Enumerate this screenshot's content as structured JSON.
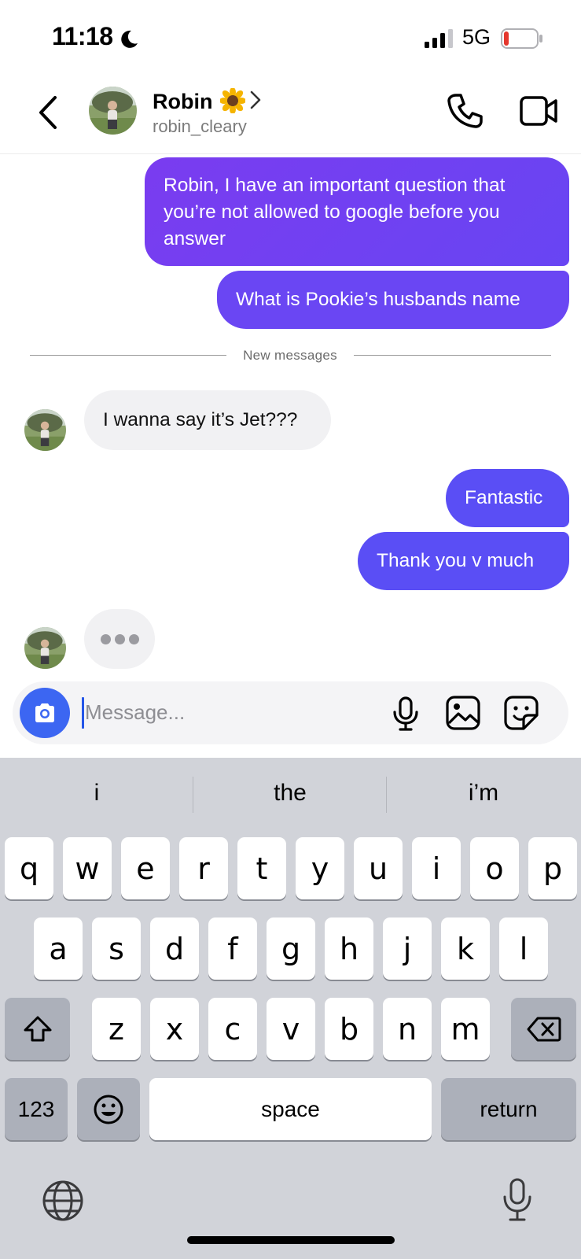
{
  "status_bar": {
    "time": "11:18",
    "network": "5G",
    "battery_color": "#e5372d"
  },
  "header": {
    "contact_name": "Robin",
    "contact_emoji": "sunflower",
    "contact_handle": "robin_cleary"
  },
  "messages": [
    {
      "direction": "outgoing",
      "text": "Robin, I have an important question that you’re not allowed to google before you answer"
    },
    {
      "direction": "outgoing",
      "text": "What is Pookie’s husbands name"
    },
    {
      "direction": "incoming",
      "text": "I wanna say it’s Jet???"
    },
    {
      "direction": "outgoing",
      "text": "Fantastic"
    },
    {
      "direction": "outgoing",
      "text": "Thank you v much"
    }
  ],
  "divider": {
    "label": "New messages"
  },
  "typing_indicator": {
    "visible": true
  },
  "composer": {
    "placeholder": "Message...",
    "value": ""
  },
  "keyboard": {
    "suggestions": [
      "i",
      "the",
      "i’m"
    ],
    "row1": [
      "q",
      "w",
      "e",
      "r",
      "t",
      "y",
      "u",
      "i",
      "o",
      "p"
    ],
    "row2": [
      "a",
      "s",
      "d",
      "f",
      "g",
      "h",
      "j",
      "k",
      "l"
    ],
    "row3": [
      "z",
      "x",
      "c",
      "v",
      "b",
      "n",
      "m"
    ],
    "numbers_label": "123",
    "space_label": "space",
    "return_label": "return"
  },
  "colors": {
    "outgoing_bubble": "#5a4ef5",
    "outgoing_bubble_top": "#7a3cf0",
    "incoming_bubble": "#f1f1f3",
    "camera_button": "#3c66f2",
    "keyboard_bg": "#d1d3d9"
  }
}
